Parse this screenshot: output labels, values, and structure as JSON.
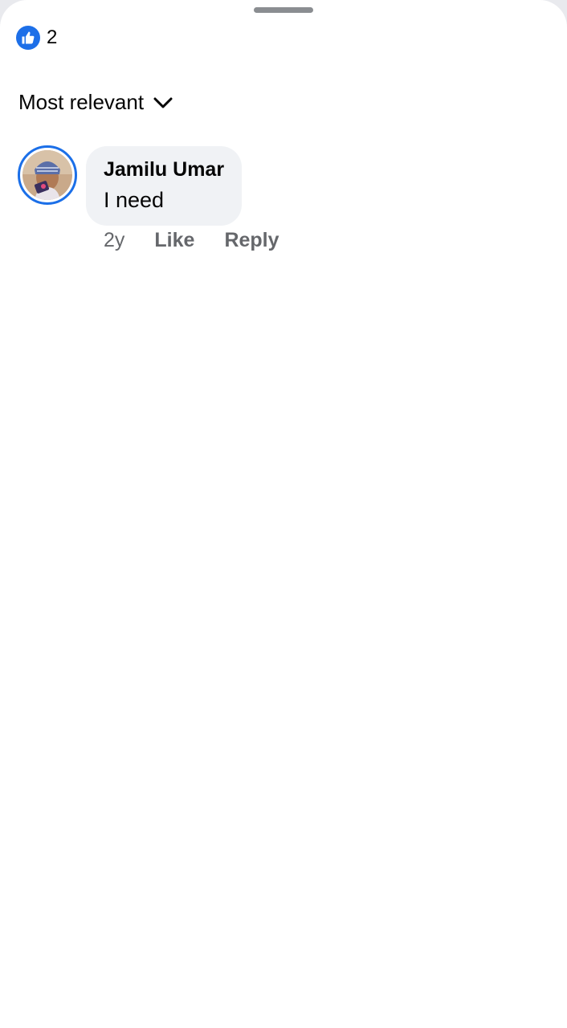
{
  "reactions": {
    "icon": "thumbs-up-icon",
    "count": "2",
    "badge_color": "#1d6fe8"
  },
  "sort": {
    "label": "Most relevant",
    "icon": "chevron-down-icon"
  },
  "comments": [
    {
      "author": "Jamilu Umar",
      "text": "I need",
      "time": "2y",
      "like_label": "Like",
      "reply_label": "Reply",
      "avatar_ring_color": "#1b6fe8"
    }
  ]
}
